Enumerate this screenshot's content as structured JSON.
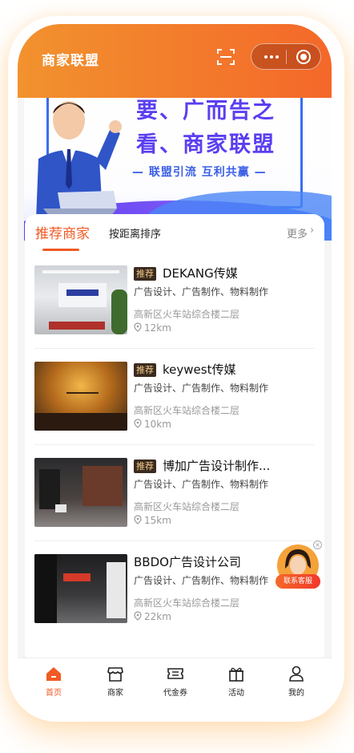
{
  "header": {
    "title": "商家联盟",
    "scan_icon": "scan-icon",
    "menu_icon": "more-dots-icon",
    "close_icon": "close-miniapp-icon"
  },
  "banner": {
    "line1": "要、广而告之",
    "line2": "看、商家联盟",
    "slogan": "— 联盟引流  互利共赢 —",
    "slide_count": 4,
    "active_slide": 2
  },
  "tabs": {
    "recommended": "推荐商家",
    "by_distance": "按距离排序",
    "more": "更多",
    "more_arrow": "›"
  },
  "merchants": [
    {
      "badge": "推荐",
      "name": "DEKANG传媒",
      "services": "广告设计、广告制作、物料制作",
      "address": "高新区火车站综合楼二层",
      "distance": "12km"
    },
    {
      "badge": "推荐",
      "name": "keywest传媒",
      "services": "广告设计、广告制作、物料制作",
      "address": "高新区火车站综合楼二层",
      "distance": "10km"
    },
    {
      "badge": "推荐",
      "name": "博加广告设计制作...",
      "services": "广告设计、广告制作、物料制作",
      "address": "高新区火车站综合楼二层",
      "distance": "15km"
    },
    {
      "badge": "",
      "name": "BBDO广告设计公司",
      "services": "广告设计、广告制作、物料制作",
      "address": "高新区火车站综合楼二层",
      "distance": "22km"
    }
  ],
  "float_service": {
    "label": "联系客服",
    "close": "×"
  },
  "tabbar": [
    {
      "label": "首页",
      "icon": "home-icon",
      "active": true
    },
    {
      "label": "商家",
      "icon": "store-icon",
      "active": false
    },
    {
      "label": "代金券",
      "icon": "coupon-icon",
      "active": false
    },
    {
      "label": "活动",
      "icon": "gift-icon",
      "active": false
    },
    {
      "label": "我的",
      "icon": "user-icon",
      "active": false
    }
  ],
  "colors": {
    "accent": "#f15a24",
    "header_start": "#f2922e",
    "header_end": "#f4682a",
    "banner_text": "#5a3ff0"
  }
}
